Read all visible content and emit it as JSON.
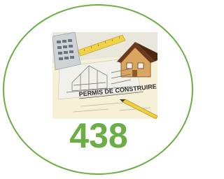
{
  "badge": {
    "count": "438",
    "accent_color": "#6aae45"
  },
  "photo": {
    "document_title": "PERMIS DE CONSTRUIRE",
    "icons": [
      "calculator-icon",
      "ruler-icon",
      "house-model-icon",
      "pen-icon"
    ]
  }
}
